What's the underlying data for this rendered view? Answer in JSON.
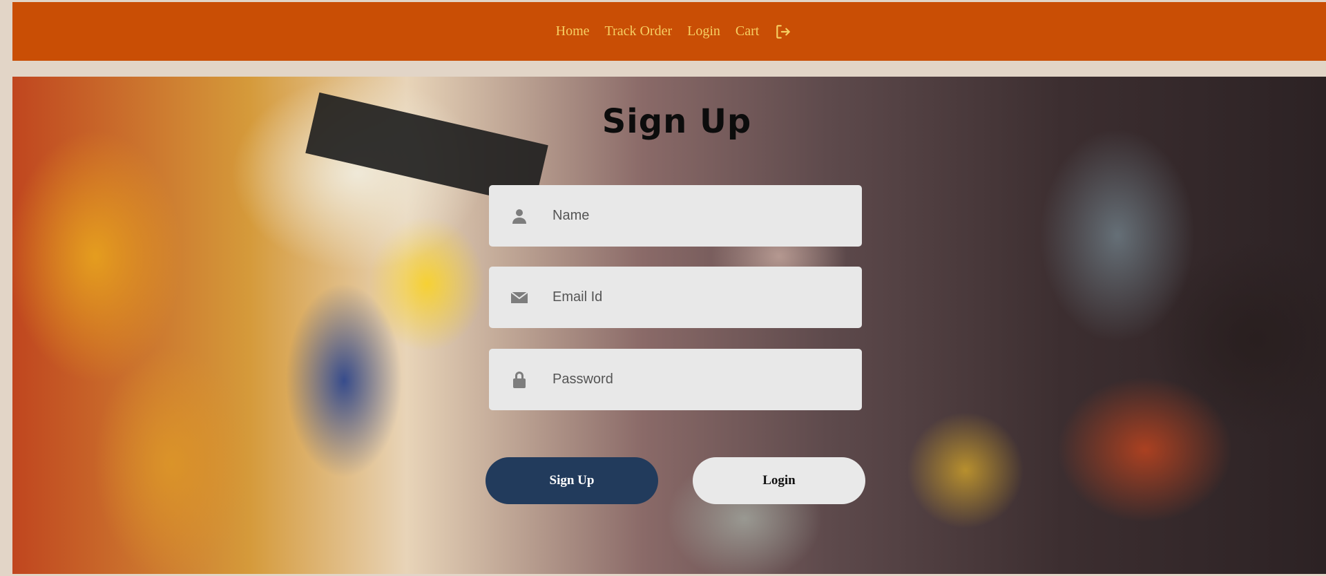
{
  "nav": {
    "links": [
      "Home",
      "Track Order",
      "Login",
      "Cart"
    ],
    "logout_icon": "logout-icon",
    "background": "#c94e05",
    "link_color": "#f6cf63"
  },
  "hero": {
    "background_image": "toy robots shelf photo"
  },
  "form": {
    "title": "Sign Up",
    "name": {
      "placeholder": "Name",
      "value": "",
      "icon": "user-icon"
    },
    "email": {
      "placeholder": "Email Id",
      "value": "",
      "icon": "envelope-icon"
    },
    "password": {
      "placeholder": "Password",
      "value": "",
      "icon": "lock-icon"
    },
    "signup_button": "Sign Up",
    "login_button": "Login",
    "signup_color": "#223b5c"
  }
}
